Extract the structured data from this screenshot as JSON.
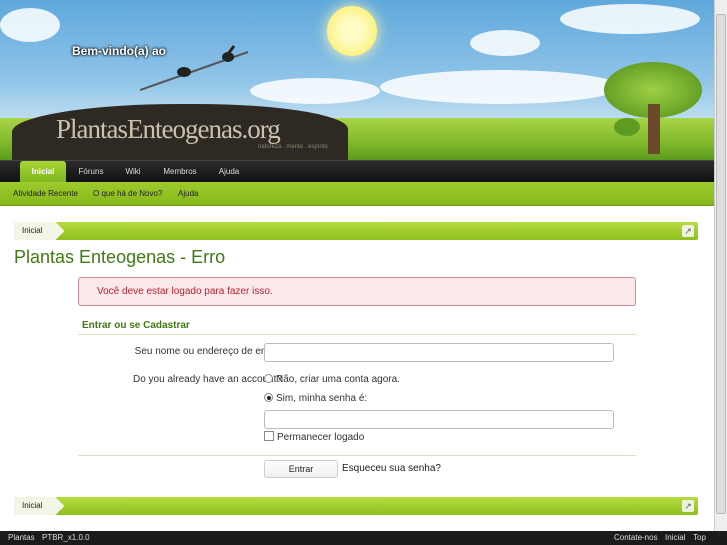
{
  "header": {
    "welcome": "Bem-vindo(a) ao",
    "logo": "PlantasEnteogenas.org",
    "logo_sub": "natureza . mente . espírito"
  },
  "nav": {
    "tabs": [
      "Inicial",
      "Fóruns",
      "Wiki",
      "Membros",
      "Ajuda"
    ],
    "active": "Inicial",
    "subnav": [
      "Atividade Recente",
      "O que há de Novo?",
      "Ajuda"
    ]
  },
  "breadcrumb": {
    "home": "Inicial"
  },
  "page": {
    "title": "Plantas Enteogenas - Erro",
    "error": "Você deve estar logado para fazer isso."
  },
  "login": {
    "section_title": "Entrar ou se Cadastrar",
    "username_label": "Seu nome ou endereço de email:",
    "account_label": "Do you already have an account?",
    "option_no": "Não, criar uma conta agora.",
    "option_yes": "Sim, minha senha é:",
    "selected": "yes",
    "remember": "Permanecer logado",
    "submit": "Entrar",
    "forgot": "Esqueceu sua senha?"
  },
  "footer": {
    "style": "Plantas",
    "language": "PTBR_x1.0.0",
    "contact": "Contate-nos",
    "home": "Inicial",
    "top": "Top"
  },
  "colors": {
    "accent_green": "#8fbf20",
    "title_green": "#3f7a12",
    "error_red": "#b3262f"
  }
}
